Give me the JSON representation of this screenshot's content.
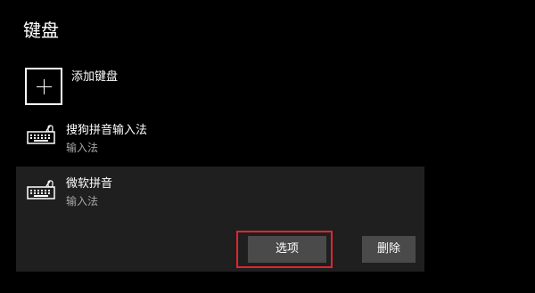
{
  "page": {
    "title": "键盘"
  },
  "add_keyboard": {
    "label": "添加键盘",
    "icon": "plus-icon"
  },
  "keyboards": [
    {
      "name": "搜狗拼音输入法",
      "type": "输入法",
      "icon": "keyboard-icon"
    },
    {
      "name": "微软拼音",
      "type": "输入法",
      "icon": "keyboard-icon",
      "selected": true
    }
  ],
  "actions": {
    "options_label": "选项",
    "remove_label": "删除"
  },
  "colors": {
    "background": "#000000",
    "selected_item": "#1f1f1f",
    "button": "#4a4a4a",
    "highlight": "#e0262f",
    "secondary_text": "#a6a6a6"
  }
}
